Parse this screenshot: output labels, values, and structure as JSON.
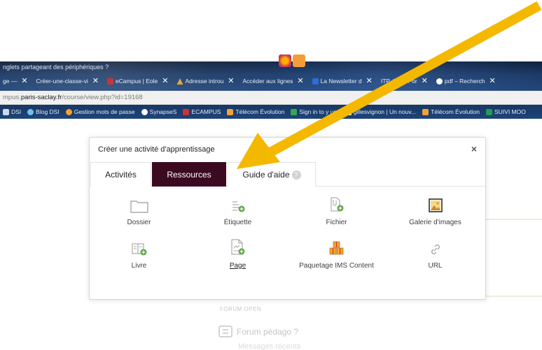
{
  "browser": {
    "title_bar": "nglets partageant des périphériques  ?",
    "tabs": [
      {
        "label": "ge —",
        "color": "#8aa"
      },
      {
        "label": "Créer-une-classe-vi",
        "color": "#6c8"
      },
      {
        "label": "eCampus | Eole",
        "color": "#c33"
      },
      {
        "label": "Adresse introu",
        "color": "#e8a33a"
      },
      {
        "label": "Accéder aux lignes",
        "color": "#ffffff"
      },
      {
        "label": "La Newsletter d",
        "color": "#2a6fd6"
      },
      {
        "label": "ITP 403 – For",
        "color": "#7a5"
      },
      {
        "label": "pdf – Recherch",
        "color": "#4285f4"
      }
    ],
    "url_prefix": "mpus.",
    "url_host": "paris-saclay.fr",
    "url_path": "/course/view.php?id=19168",
    "bookmarks": [
      {
        "label": "DSI",
        "color": "#cfd8e6"
      },
      {
        "label": "Blog DSI",
        "color": "#6bc1f2"
      },
      {
        "label": "Gestion mots de passe",
        "color": "#f3a32c"
      },
      {
        "label": "SynapseS",
        "color": "#ffffff"
      },
      {
        "label": "ECAMPUS",
        "color": "#c33"
      },
      {
        "label": "Télécom Évolution",
        "color": "#f0a33a"
      },
      {
        "label": "Sign in to y      unt",
        "color": "#34a853"
      },
      {
        "label": "gillesvignon | Un nouv...",
        "color": "#ffffff"
      },
      {
        "label": "Télécom Évolution",
        "color": "#f0a33a"
      },
      {
        "label": "SUIVI MOO",
        "color": "#1f9d55"
      }
    ]
  },
  "modal": {
    "title": "Créer une activité d'apprentissage",
    "close": "×",
    "tabs": [
      {
        "label": "Activités"
      },
      {
        "label": "Ressources"
      },
      {
        "label": "Guide d'aide",
        "badge": "?"
      }
    ],
    "items": [
      {
        "label": "Dossier",
        "icon": "folder-icon"
      },
      {
        "label": "Étiquette",
        "icon": "label-icon"
      },
      {
        "label": "Fichier",
        "icon": "file-icon"
      },
      {
        "label": "Galerie d'images",
        "icon": "image-gallery-icon"
      },
      {
        "label": "Livre",
        "icon": "book-icon"
      },
      {
        "label": "Page",
        "icon": "page-icon"
      },
      {
        "label": "Paquetage IMS Content",
        "icon": "ims-package-icon"
      },
      {
        "label": "URL",
        "icon": "link-icon"
      }
    ]
  },
  "background": {
    "section_heading": "FORUM OPEN",
    "forum_title": "Forum pédago ?",
    "forum_subtitle": "Messages récents"
  },
  "colors": {
    "accent": "#3b0a21",
    "arrow": "#f5b800",
    "add_green": "#5aa544"
  }
}
